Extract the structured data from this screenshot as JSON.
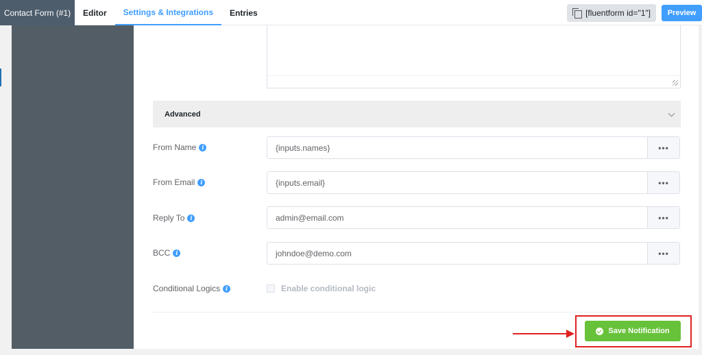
{
  "header": {
    "form_tab": "Contact Form (#1)",
    "tabs": [
      {
        "label": "Editor"
      },
      {
        "label": "Settings & Integrations",
        "active": true
      },
      {
        "label": "Entries"
      }
    ],
    "shortcode": "[fluentform id=\"1\"]",
    "preview_label": "Preview"
  },
  "advanced": {
    "label": "Advanced"
  },
  "fields": [
    {
      "label": "From Name",
      "value": "{inputs.names}"
    },
    {
      "label": "From Email",
      "value": "{inputs.email}"
    },
    {
      "label": "Reply To",
      "value": "admin@email.com"
    },
    {
      "label": "BCC",
      "value": "johndoe@demo.com"
    }
  ],
  "more_label": "•••",
  "conditional": {
    "label": "Conditional Logics",
    "checkbox_label": "Enable conditional logic",
    "checked": false
  },
  "save_label": "Save Notification",
  "colors": {
    "accent": "#409eff",
    "save": "#67c23a",
    "sidebar": "#535d66",
    "highlight": "#e02020"
  },
  "icons": [
    "copy-icon",
    "info-icon",
    "chevron-down-icon",
    "check-circle-icon",
    "resize-handle-icon",
    "arrow-annotation"
  ]
}
